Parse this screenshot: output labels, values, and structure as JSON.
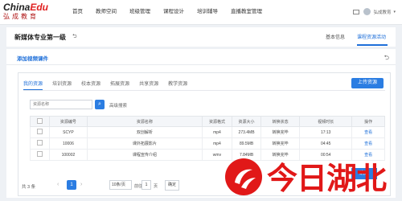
{
  "brand": {
    "en_main": "China",
    "en_accent": "Edu",
    "cn": "弘成教育"
  },
  "nav": [
    "首页",
    "教师空间",
    "班级管理",
    "课程设计",
    "培训辅导",
    "直播教室管理"
  ],
  "user": {
    "name": "弘成教育"
  },
  "course": {
    "title": "新媒体专业第一级"
  },
  "top_tabs": [
    "基本信息",
    "课程资源活动"
  ],
  "panel": {
    "title": "添加视频课件"
  },
  "tabs": [
    "我的资源",
    "培训资源",
    "校本资源",
    "拓展资源",
    "共享资源",
    "教学资源"
  ],
  "upload_label": "上传资源",
  "search": {
    "placeholder": "资源名称",
    "advanced": "高级搜索"
  },
  "table": {
    "headers": [
      "",
      "资源编号",
      "资源名称",
      "资源格式",
      "资源大小",
      "转换状态",
      "视频时长",
      "操作"
    ],
    "rows": [
      {
        "id": "SCYP",
        "name": "双创解析",
        "format": "mp4",
        "size": "273.4MB",
        "status": "转换完毕",
        "duration": "17:13",
        "op": "查看"
      },
      {
        "id": "10006",
        "name": "课外拓展影片",
        "format": "mp4",
        "size": "89.5MB",
        "status": "转换完毕",
        "duration": "04:45",
        "op": "查看"
      },
      {
        "id": "100002",
        "name": "课程宣传介绍",
        "format": "wmv",
        "size": "7.84MB",
        "status": "转换完毕",
        "duration": "00:54",
        "op": "查看"
      }
    ]
  },
  "pager": {
    "total": "共 3 条",
    "current": "1",
    "size": "10条/页",
    "goto_label": "前往",
    "goto_value": "1",
    "goto_suffix": "页",
    "confirm": "确定"
  },
  "watermark": {
    "text": "今日湖北"
  },
  "next_label": "确定",
  "colors": {
    "accent": "#1e6fd9",
    "button": "#2b7de2",
    "watermark": "#e11818",
    "brand_red": "#e02020"
  }
}
